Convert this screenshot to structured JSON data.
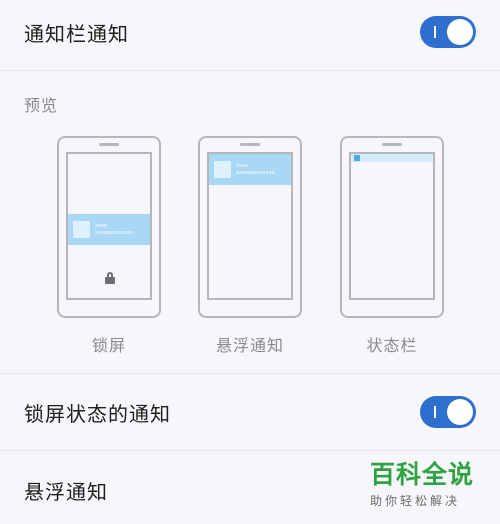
{
  "rows": {
    "statusbar_notification": {
      "label": "通知栏通知",
      "enabled": true
    },
    "lockscreen_notification": {
      "label": "锁屏状态的通知",
      "enabled": true
    },
    "floating_notification": {
      "label": "悬浮通知"
    }
  },
  "preview": {
    "label": "预览",
    "options": [
      {
        "caption": "锁屏",
        "line1": "xxxx",
        "line2": "xxxxxxxxxxxxx"
      },
      {
        "caption": "悬浮通知",
        "line1": "xxxx",
        "line2": "xxxxxxxxxxxxx"
      },
      {
        "caption": "状态栏"
      }
    ]
  },
  "watermark": {
    "title": "百科全说",
    "subtitle": "助你轻松解决"
  },
  "colors": {
    "toggle_on": "#2f6fd0",
    "notification_blue": "#a9d8f7",
    "background": "#f7f6fa",
    "watermark_green": "#2fa343"
  }
}
